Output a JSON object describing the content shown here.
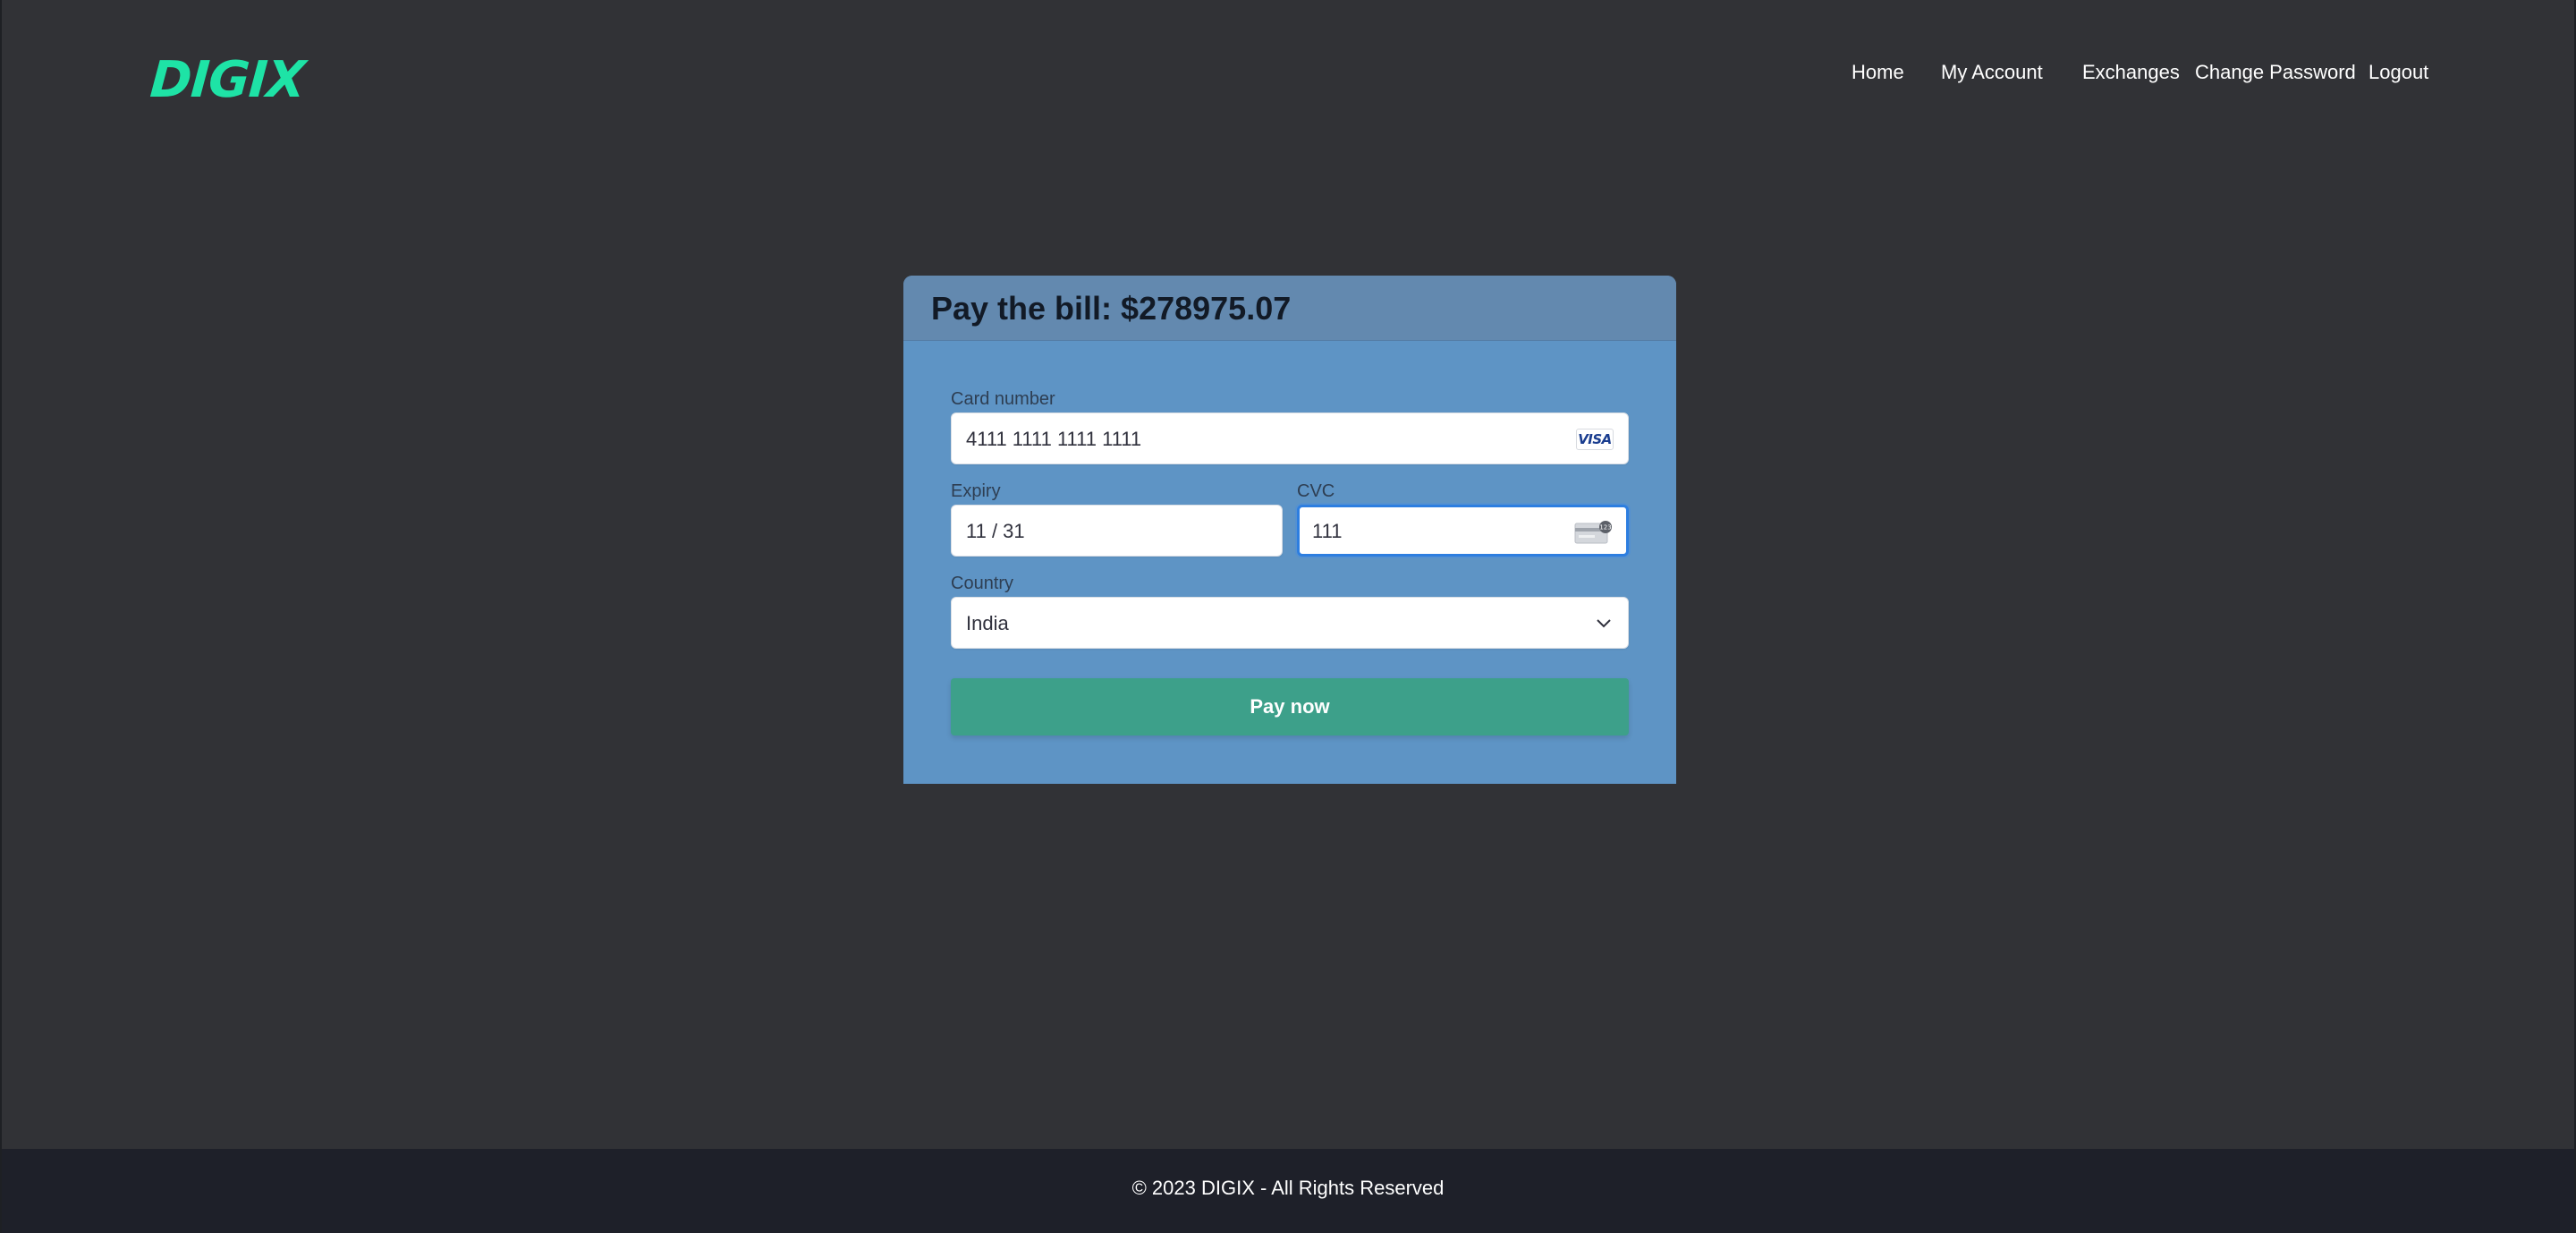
{
  "brand": {
    "logo_text": "DIGIX",
    "color": "#1ee3a6"
  },
  "nav": {
    "items": [
      "Home",
      "My Account",
      "Exchanges",
      "Change Password",
      "Logout"
    ]
  },
  "payment": {
    "title": "Pay the bill: $278975.07",
    "card_number_label": "Card number",
    "card_number_value": "4111 1111 1111 1111",
    "card_brand": "VISA",
    "expiry_label": "Expiry",
    "expiry_value": "11 / 31",
    "cvc_label": "CVC",
    "cvc_value": "111",
    "cvc_icon": "cvc-card-icon",
    "country_label": "Country",
    "country_value": "India",
    "pay_button": "Pay now",
    "accent": "#3da08a",
    "panel_color": "#5e94c5"
  },
  "footer": {
    "text": "© 2023 DIGIX - All Rights Reserved"
  }
}
